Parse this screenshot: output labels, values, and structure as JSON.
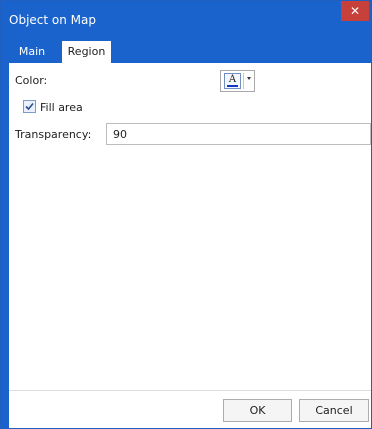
{
  "dialog": {
    "title": "Object on Map",
    "close_label": "✕"
  },
  "tabs": [
    {
      "label": "Main",
      "active": false
    },
    {
      "label": "Region",
      "active": true
    }
  ],
  "region": {
    "color_label": "Color:",
    "color_button_glyph": "A",
    "color_value": "#1436c8",
    "fill_area_label": "Fill area",
    "fill_area_checked": true,
    "transparency_label": "Transparency:",
    "transparency_value": "90"
  },
  "footer": {
    "ok_label": "OK",
    "cancel_label": "Cancel"
  },
  "colors": {
    "accent": "#1b63cc",
    "close": "#c7403a"
  }
}
